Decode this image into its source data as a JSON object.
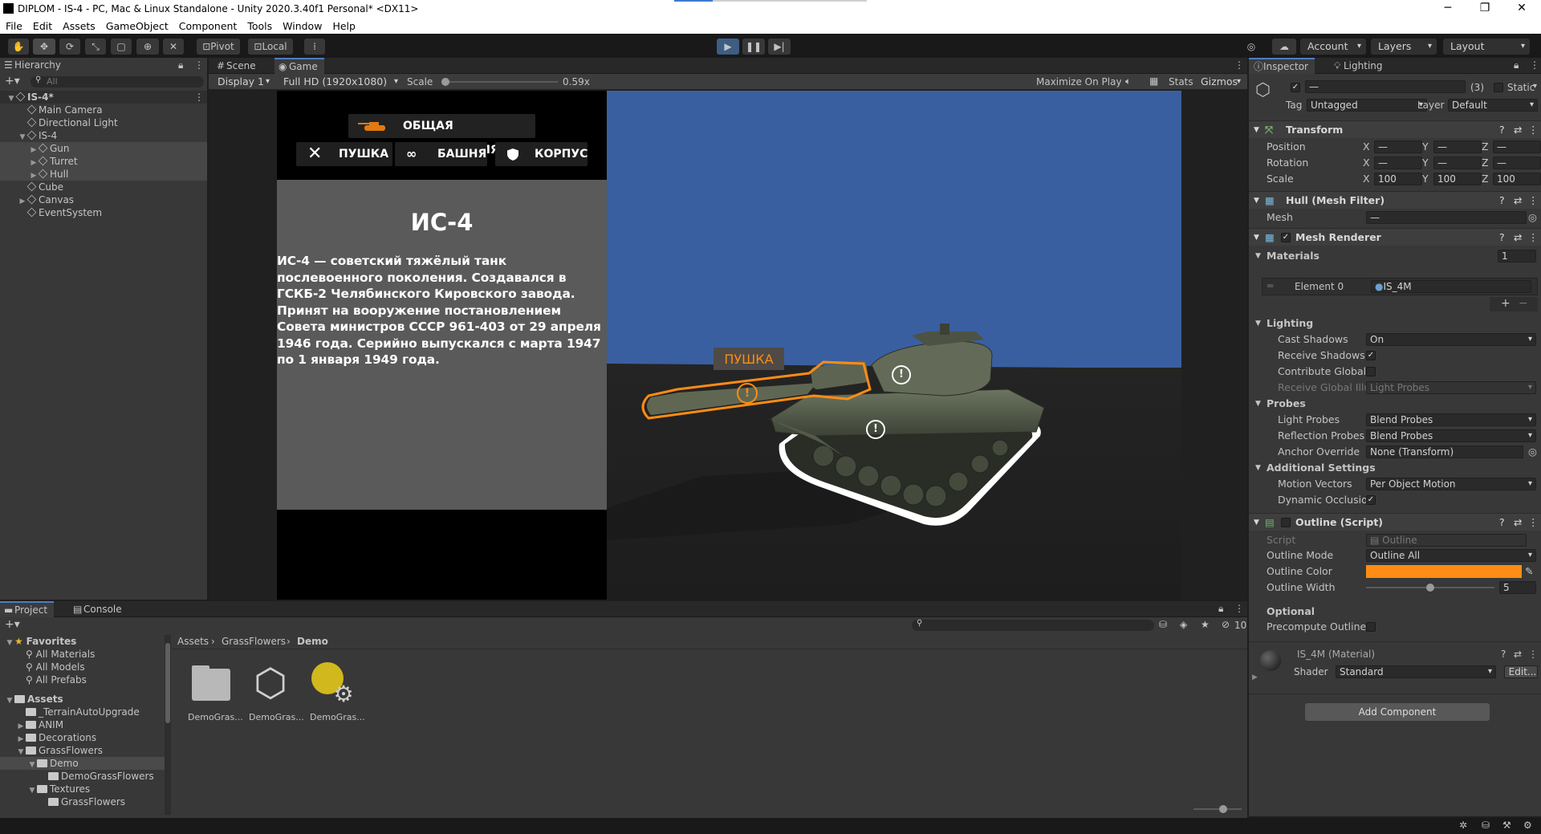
{
  "titlebar": {
    "title": "DIPLOM - IS-4 - PC, Mac & Linux Standalone - Unity 2020.3.40f1 Personal* <DX11>",
    "minimize": "─",
    "maximize": "❐",
    "close": "✕"
  },
  "menu": [
    "File",
    "Edit",
    "Assets",
    "GameObject",
    "Component",
    "Tools",
    "Window",
    "Help"
  ],
  "toolbar": {
    "pivot": "Pivot",
    "local": "Local",
    "account": "Account",
    "layers": "Layers",
    "layout": "Layout"
  },
  "hierarchy": {
    "tab": "Hierarchy",
    "search_placeholder": "All",
    "items": [
      {
        "label": "IS-4*",
        "depth": 0,
        "expanded": true,
        "scene": true,
        "selected": false
      },
      {
        "label": "Main Camera",
        "depth": 1,
        "expanded": null,
        "selected": false
      },
      {
        "label": "Directional Light",
        "depth": 1,
        "expanded": null,
        "selected": false
      },
      {
        "label": "IS-4",
        "depth": 1,
        "expanded": true,
        "selected": false
      },
      {
        "label": "Gun",
        "depth": 2,
        "expanded": false,
        "selected": true
      },
      {
        "label": "Turret",
        "depth": 2,
        "expanded": false,
        "selected": true
      },
      {
        "label": "Hull",
        "depth": 2,
        "expanded": false,
        "selected": true
      },
      {
        "label": "Cube",
        "depth": 1,
        "expanded": null,
        "selected": false
      },
      {
        "label": "Canvas",
        "depth": 1,
        "expanded": false,
        "selected": false
      },
      {
        "label": "EventSystem",
        "depth": 1,
        "expanded": null,
        "selected": false
      }
    ]
  },
  "game": {
    "tabs": [
      "Scene",
      "Game"
    ],
    "display": "Display 1",
    "resolution": "Full HD (1920x1080)",
    "scale_label": "Scale",
    "scale_value": 0.59,
    "scale_text": "0.59x",
    "maximize": "Maximize On Play",
    "stats": "Stats",
    "gizmos": "Gizmos",
    "buttons": {
      "info": "ОБЩАЯ ИНФОРМАЦИЯ",
      "gun": "ПУШКА",
      "turret": "БАШНЯ",
      "hull": "КОРПУС"
    },
    "panel_title": "ИС-4",
    "panel_text": "ИС-4 — советский тяжёлый танк послевоенного поколения. Создавался в ГСКБ-2 Челябинского Кировского завода. Принят на вооружение постановлением Совета министров СССР 961-403 от 29 апреля 1946 года. Серийно выпускался с марта 1947 по 1 января 1949 года.",
    "tooltip": "ПУШКА",
    "marker": "!",
    "colors": {
      "outline": "#ff8c14",
      "sky": "#3a5fa0"
    }
  },
  "inspector": {
    "tabs": [
      "Inspector",
      "Lighting"
    ],
    "name_value": "—",
    "count": "(3)",
    "static": "Static",
    "tag_label": "Tag",
    "tag_value": "Untagged",
    "layer_label": "Layer",
    "layer_value": "Default",
    "transform": {
      "title": "Transform",
      "position": "Position",
      "rotation": "Rotation",
      "scale": "Scale",
      "pos": {
        "x": "—",
        "y": "—",
        "z": "—"
      },
      "rot": {
        "x": "—",
        "y": "—",
        "z": "—"
      },
      "scl": {
        "x": "100",
        "y": "100",
        "z": "100"
      }
    },
    "meshfilter": {
      "title": "Hull (Mesh Filter)",
      "mesh_label": "Mesh",
      "mesh_value": "—"
    },
    "renderer": {
      "title": "Mesh Renderer",
      "materials": "Materials",
      "mat_count": "1",
      "element0": "Element 0",
      "element0_value": "IS_4M",
      "lighting": "Lighting",
      "cast_shadows": "Cast Shadows",
      "cast_value": "On",
      "receive_shadows": "Receive Shadows",
      "contribute_gi": "Contribute Global Il",
      "receive_gi": "Receive Global Illu",
      "receive_gi_value": "Light Probes",
      "probes": "Probes",
      "light_probes": "Light Probes",
      "light_probes_value": "Blend Probes",
      "reflection_probes": "Reflection Probes",
      "reflection_probes_value": "Blend Probes",
      "anchor": "Anchor Override",
      "anchor_value": "None (Transform)",
      "additional": "Additional Settings",
      "motion_vectors": "Motion Vectors",
      "motion_value": "Per Object Motion",
      "dynamic_occlusion": "Dynamic Occlusior"
    },
    "outline": {
      "title": "Outline (Script)",
      "script_label": "Script",
      "script_value": "Outline",
      "mode_label": "Outline Mode",
      "mode_value": "Outline All",
      "color_label": "Outline Color",
      "color_value": "#ff8c14",
      "width_label": "Outline Width",
      "width_value": "5",
      "width_fraction": 0.5,
      "optional": "Optional",
      "precompute": "Precompute Outline"
    },
    "material": {
      "title": "IS_4M (Material)",
      "shader_label": "Shader",
      "shader_value": "Standard",
      "edit": "Edit..."
    },
    "add_component": "Add Component"
  },
  "project": {
    "tabs": [
      "Project",
      "Console"
    ],
    "hidden_count": "10",
    "favorites": {
      "title": "Favorites",
      "items": [
        "All Materials",
        "All Models",
        "All Prefabs"
      ]
    },
    "assets": {
      "title": "Assets",
      "items": [
        {
          "label": "_TerrainAutoUpgrade",
          "depth": 1,
          "arrow": ""
        },
        {
          "label": "ANIM",
          "depth": 1,
          "arrow": "▶"
        },
        {
          "label": "Decorations",
          "depth": 1,
          "arrow": "▶"
        },
        {
          "label": "GrassFlowers",
          "depth": 1,
          "arrow": "▼"
        },
        {
          "label": "Demo",
          "depth": 2,
          "arrow": "▼",
          "selected": true
        },
        {
          "label": "DemoGrassFlowers",
          "depth": 3,
          "arrow": ""
        },
        {
          "label": "Textures",
          "depth": 2,
          "arrow": "▼"
        },
        {
          "label": "GrassFlowers",
          "depth": 3,
          "arrow": ""
        }
      ]
    },
    "breadcrumb": [
      "Assets",
      "GrassFlowers",
      "Demo"
    ],
    "files": [
      "DemoGras...",
      "DemoGras...",
      "DemoGras..."
    ]
  }
}
